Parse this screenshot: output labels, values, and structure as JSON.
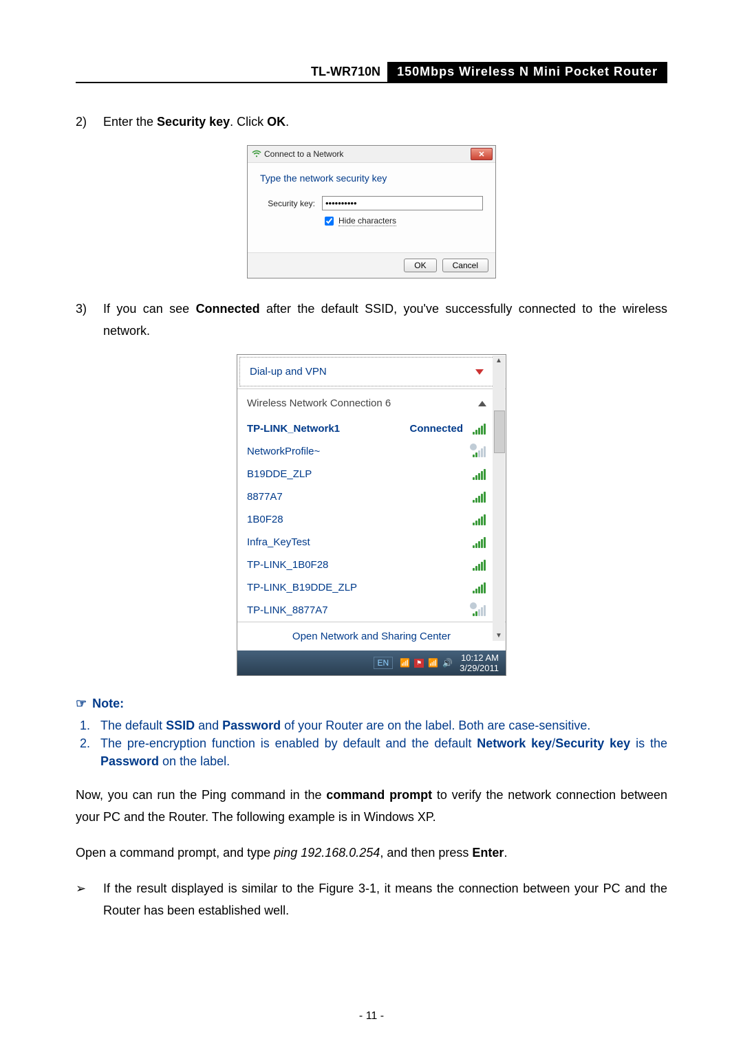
{
  "header": {
    "model": "TL-WR710N",
    "description": "150Mbps Wireless N Mini Pocket Router"
  },
  "step2": {
    "num": "2)",
    "prefix": "Enter the ",
    "bold1": "Security key",
    "mid": ". Click ",
    "bold2": "OK",
    "suffix": "."
  },
  "dialog": {
    "title": "Connect to a Network",
    "instruction": "Type the network security key",
    "field_label": "Security key:",
    "field_value": "••••••••••",
    "checkbox_label": "Hide characters",
    "checkbox_checked": true,
    "ok": "OK",
    "cancel": "Cancel"
  },
  "step3": {
    "num": "3)",
    "p1": "If you can see ",
    "bold1": "Connected",
    "p2": " after the default SSID, you've successfully connected to the wireless network."
  },
  "netlist": {
    "section_dialup": "Dial-up and VPN",
    "section_wlan": "Wireless Network Connection 6",
    "items": [
      {
        "label": "TP-LINK_Network1",
        "status": "Connected",
        "signal": "full",
        "bold": true,
        "warn": false
      },
      {
        "label": "NetworkProfile~",
        "status": "",
        "signal": "weak",
        "bold": false,
        "warn": true
      },
      {
        "label": "B19DDE_ZLP",
        "status": "",
        "signal": "full",
        "bold": false,
        "warn": false
      },
      {
        "label": "8877A7",
        "status": "",
        "signal": "full",
        "bold": false,
        "warn": false
      },
      {
        "label": "1B0F28",
        "status": "",
        "signal": "full",
        "bold": false,
        "warn": false
      },
      {
        "label": "Infra_KeyTest",
        "status": "",
        "signal": "full",
        "bold": false,
        "warn": false
      },
      {
        "label": "TP-LINK_1B0F28",
        "status": "",
        "signal": "full",
        "bold": false,
        "warn": false
      },
      {
        "label": "TP-LINK_B19DDE_ZLP",
        "status": "",
        "signal": "full",
        "bold": false,
        "warn": false
      },
      {
        "label": "TP-LINK_8877A7",
        "status": "",
        "signal": "weak",
        "bold": false,
        "warn": true
      }
    ],
    "footer_link": "Open Network and Sharing Center",
    "lang": "EN",
    "clock_time": "10:12 AM",
    "clock_date": "3/29/2011"
  },
  "note": {
    "heading": "Note:",
    "n1_num": "1.",
    "n1_a": "The default ",
    "n1_b": "SSID",
    "n1_c": " and ",
    "n1_d": "Password",
    "n1_e": " of your Router are on the label. Both are case-sensitive.",
    "n2_num": "2.",
    "n2_a": "The pre-encryption function is enabled by default and the default ",
    "n2_b": "Network key",
    "n2_c": "/",
    "n2_d": "Security key",
    "n2_e": " is the ",
    "n2_f": "Password",
    "n2_g": " on the label."
  },
  "para1": {
    "a": "Now, you can run the Ping command in the ",
    "b": "command prompt",
    "c": " to verify the network connection between your PC and the Router. The following example is in Windows XP."
  },
  "para2": {
    "a": "Open a command prompt, and type ",
    "b": "ping 192.168.0.254",
    "c": ", and then press ",
    "d": "Enter",
    "e": "."
  },
  "bullet": {
    "mark": "➢",
    "text": "If the result displayed is similar to the Figure 3-1, it means the connection between your PC and the Router has been established well."
  },
  "pagenum": "- 11 -"
}
